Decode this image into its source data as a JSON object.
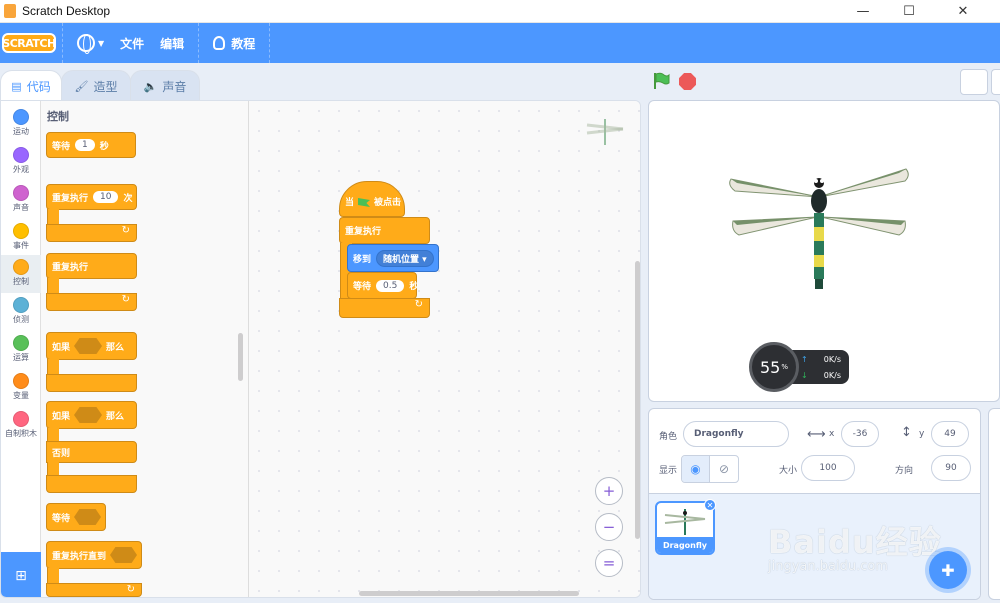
{
  "window": {
    "title": "Scratch Desktop"
  },
  "menubar": {
    "logo": "SCRATCH",
    "file": "文件",
    "edit": "编辑",
    "tutorials": "教程"
  },
  "tabs": [
    {
      "label": "代码"
    },
    {
      "label": "造型"
    },
    {
      "label": "声音"
    }
  ],
  "categories": [
    {
      "label": "运动",
      "color": "#4c97ff"
    },
    {
      "label": "外观",
      "color": "#9966ff"
    },
    {
      "label": "声音",
      "color": "#cf63cf"
    },
    {
      "label": "事件",
      "color": "#ffbf00"
    },
    {
      "label": "控制",
      "color": "#ffab19"
    },
    {
      "label": "侦测",
      "color": "#5cb1d6"
    },
    {
      "label": "运算",
      "color": "#59c059"
    },
    {
      "label": "变量",
      "color": "#ff8c1a"
    },
    {
      "label": "自制积木",
      "color": "#ff6680"
    }
  ],
  "palette": {
    "title": "控制",
    "wait": {
      "label": "等待",
      "value": "1",
      "unit": "秒"
    },
    "repeat": {
      "label": "重复执行",
      "value": "10",
      "unit": "次"
    },
    "forever": {
      "label": "重复执行"
    },
    "if_then": {
      "if": "如果",
      "then": "那么"
    },
    "if_else": {
      "if": "如果",
      "then": "那么",
      "else": "否则"
    },
    "wait_until": {
      "label": "等待"
    },
    "repeat_until": {
      "label": "重复执行直到"
    }
  },
  "script": {
    "when_flag": {
      "pre": "当",
      "post": "被点击"
    },
    "forever": "重复执行",
    "goto": {
      "label": "移到",
      "target": "随机位置"
    },
    "wait": {
      "label": "等待",
      "value": "0.5",
      "unit": "秒"
    }
  },
  "zoom": {
    "in": "+",
    "out": "−",
    "reset": "="
  },
  "speed_widget": {
    "percent": "55",
    "percent_sign": "%",
    "up": "0K/s",
    "down": "0K/s"
  },
  "sprite_info": {
    "sprite_label": "角色",
    "sprite_name": "Dragonfly",
    "x_label": "x",
    "x_value": "-36",
    "y_label": "y",
    "y_value": "49",
    "show_label": "显示",
    "size_label": "大小",
    "size_value": "100",
    "direction_label": "方向",
    "direction_value": "90"
  },
  "sprites": [
    {
      "name": "Dragonfly"
    }
  ],
  "watermark": {
    "big": "Baidu经验",
    "small": "jingyan.baidu.com"
  }
}
